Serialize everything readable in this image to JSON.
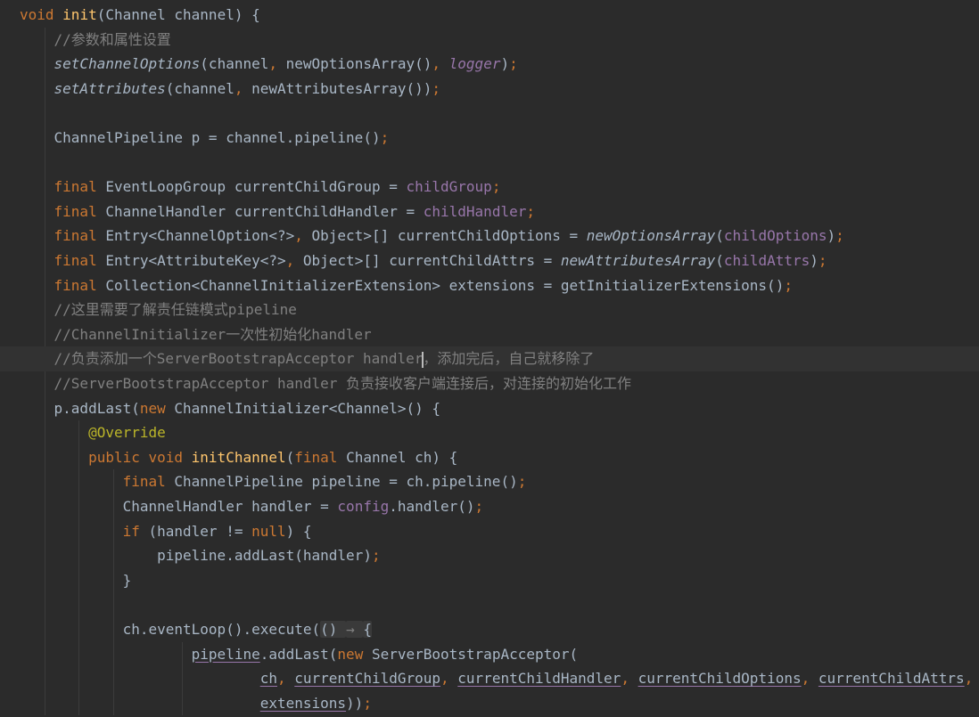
{
  "editor": {
    "current_line": 14,
    "caret_after_token": [
      14,
      0
    ],
    "colors": {
      "background": "#2b2b2b",
      "keyword": "#cc7832",
      "method": "#ffc66d",
      "field": "#9876aa",
      "comment": "#808080",
      "text": "#a9b7c6",
      "annotation": "#bbb529"
    },
    "gutter_icon": "intention-bulb-icon",
    "lines": [
      [
        [
          "void ",
          "k"
        ],
        [
          "init",
          "fn"
        ],
        [
          "(Channel channel) {",
          "t"
        ]
      ],
      [
        [
          "    //参数和属性设置",
          "c"
        ]
      ],
      [
        [
          "    ",
          "t"
        ],
        [
          "setChannelOptions",
          "s"
        ],
        [
          "(channel",
          "t"
        ],
        [
          ", ",
          "p"
        ],
        [
          "newOptionsArray()",
          "t"
        ],
        [
          ", ",
          "p"
        ],
        [
          "logger",
          "fi"
        ],
        [
          ")",
          "t"
        ],
        [
          ";",
          "p"
        ]
      ],
      [
        [
          "    ",
          "t"
        ],
        [
          "setAttributes",
          "s"
        ],
        [
          "(channel",
          "t"
        ],
        [
          ", ",
          "p"
        ],
        [
          "newAttributesArray())",
          "t"
        ],
        [
          ";",
          "p"
        ]
      ],
      [],
      [
        [
          "    ChannelPipeline p = channel.pipeline()",
          "t"
        ],
        [
          ";",
          "p"
        ]
      ],
      [],
      [
        [
          "    ",
          "t"
        ],
        [
          "final ",
          "k"
        ],
        [
          "EventLoopGroup currentChildGroup = ",
          "t"
        ],
        [
          "childGroup",
          "f"
        ],
        [
          ";",
          "p"
        ]
      ],
      [
        [
          "    ",
          "t"
        ],
        [
          "final ",
          "k"
        ],
        [
          "ChannelHandler currentChildHandler = ",
          "t"
        ],
        [
          "childHandler",
          "f"
        ],
        [
          ";",
          "p"
        ]
      ],
      [
        [
          "    ",
          "t"
        ],
        [
          "final ",
          "k"
        ],
        [
          "Entry<ChannelOption<?>",
          "t"
        ],
        [
          ", ",
          "p"
        ],
        [
          "Object>[] currentChildOptions = ",
          "t"
        ],
        [
          "newOptionsArray",
          "s"
        ],
        [
          "(",
          "t"
        ],
        [
          "childOptions",
          "f"
        ],
        [
          ")",
          "t"
        ],
        [
          ";",
          "p"
        ]
      ],
      [
        [
          "    ",
          "t"
        ],
        [
          "final ",
          "k"
        ],
        [
          "Entry<AttributeKey<?>",
          "t"
        ],
        [
          ", ",
          "p"
        ],
        [
          "Object>[] currentChildAttrs = ",
          "t"
        ],
        [
          "newAttributesArray",
          "s"
        ],
        [
          "(",
          "t"
        ],
        [
          "childAttrs",
          "f"
        ],
        [
          ")",
          "t"
        ],
        [
          ";",
          "p"
        ]
      ],
      [
        [
          "    ",
          "t"
        ],
        [
          "final ",
          "k"
        ],
        [
          "Collection<ChannelInitializerExtension> extensions = getInitializerExtensions()",
          "t"
        ],
        [
          ";",
          "p"
        ]
      ],
      [
        [
          "    //这里需要了解责任链模式pipeline",
          "c"
        ]
      ],
      [
        [
          "    //ChannelInitializer一次性初始化handler",
          "c"
        ]
      ],
      [
        [
          "    //负责添加一个ServerBootstrapAcceptor handler",
          "c"
        ],
        [
          "，添加完后，自己就移除了",
          "c"
        ]
      ],
      [
        [
          "    //ServerBootstrapAcceptor handler 负责接收客户端连接后，对连接的初始化工作",
          "c"
        ]
      ],
      [
        [
          "    p.addLast(",
          "t"
        ],
        [
          "new ",
          "k"
        ],
        [
          "ChannelInitializer<Channel>() {",
          "t"
        ]
      ],
      [
        [
          "        ",
          "t"
        ],
        [
          "@Override",
          "a"
        ]
      ],
      [
        [
          "        ",
          "t"
        ],
        [
          "public void ",
          "k"
        ],
        [
          "initChannel",
          "fn"
        ],
        [
          "(",
          "t"
        ],
        [
          "final ",
          "k"
        ],
        [
          "Channel ch) {",
          "t"
        ]
      ],
      [
        [
          "            ",
          "t"
        ],
        [
          "final ",
          "k"
        ],
        [
          "ChannelPipeline pipeline = ch.pipeline()",
          "t"
        ],
        [
          ";",
          "p"
        ]
      ],
      [
        [
          "            ChannelHandler handler = ",
          "t"
        ],
        [
          "config",
          "f"
        ],
        [
          ".handler()",
          "t"
        ],
        [
          ";",
          "p"
        ]
      ],
      [
        [
          "            ",
          "t"
        ],
        [
          "if ",
          "k"
        ],
        [
          "(handler != ",
          "t"
        ],
        [
          "null",
          "k"
        ],
        [
          ") {",
          "t"
        ]
      ],
      [
        [
          "                pipeline.addLast(handler)",
          "t"
        ],
        [
          ";",
          "p"
        ]
      ],
      [
        [
          "            }",
          "t"
        ]
      ],
      [],
      [
        [
          "            ch.eventLoop().execute(",
          "t"
        ],
        [
          "() ",
          "lam"
        ],
        [
          "→ ",
          "lam g"
        ],
        [
          "{",
          "lam"
        ]
      ],
      [
        [
          "                    ",
          "t"
        ],
        [
          "pipeline",
          "u"
        ],
        [
          ".addLast(",
          "t"
        ],
        [
          "new ",
          "k"
        ],
        [
          "ServerBootstrapAcceptor(",
          "t"
        ]
      ],
      [
        [
          "                            ",
          "t"
        ],
        [
          "ch",
          "u"
        ],
        [
          ", ",
          "p"
        ],
        [
          "currentChildGroup",
          "u"
        ],
        [
          ", ",
          "p"
        ],
        [
          "currentChildHandler",
          "u"
        ],
        [
          ", ",
          "p"
        ],
        [
          "currentChildOptions",
          "u"
        ],
        [
          ", ",
          "p"
        ],
        [
          "currentChildAttrs",
          "u"
        ],
        [
          ",",
          "p"
        ]
      ],
      [
        [
          "                            ",
          "t"
        ],
        [
          "extensions",
          "u"
        ],
        [
          "))",
          "t"
        ],
        [
          ";",
          "p"
        ]
      ]
    ]
  }
}
